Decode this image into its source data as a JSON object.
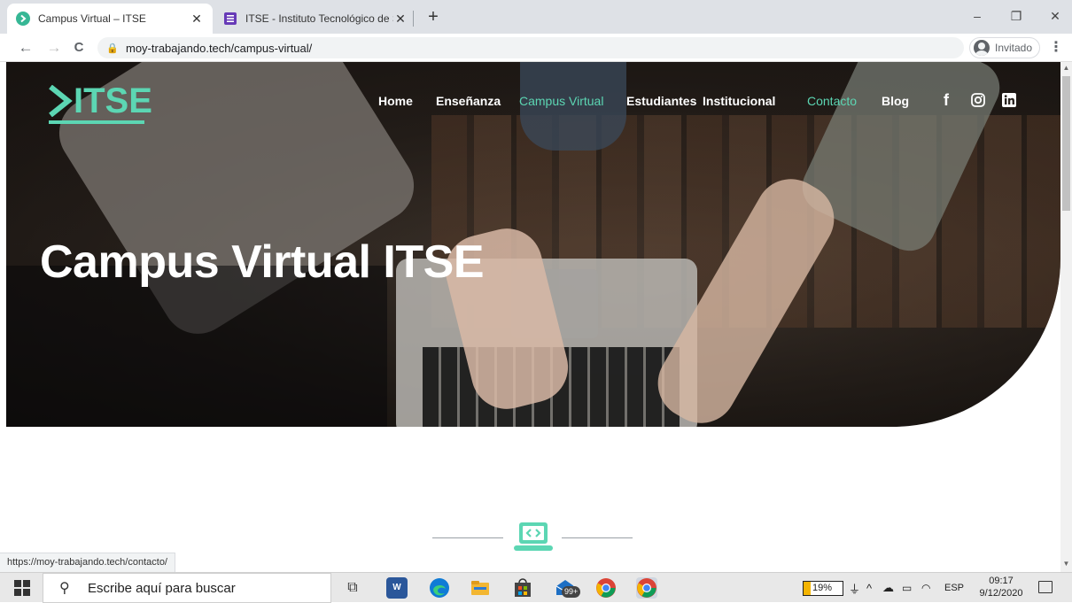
{
  "browser": {
    "tabs": [
      {
        "title": "Campus Virtual – ITSE",
        "active": true
      },
      {
        "title": "ITSE - Instituto Tecnológico de Sa",
        "active": false
      }
    ],
    "new_tab": "+",
    "window_controls": {
      "minimize": "–",
      "restore": "❐",
      "close": "✕"
    },
    "nav": {
      "back": "←",
      "forward": "→",
      "reload": "C"
    },
    "url": "moy-trabajando.tech/campus-virtual/",
    "profile_label": "Invitado",
    "menu": "⋮",
    "status_url": "https://moy-trabajando.tech/contacto/"
  },
  "site": {
    "logo": {
      "text": "ITSE",
      "color": "#5cd6b3"
    },
    "nav_items": [
      {
        "label": "Home",
        "active": false
      },
      {
        "label": "Enseñanza",
        "active": false
      },
      {
        "label": "Campus Virtual",
        "active": true
      },
      {
        "label": "Estudiantes",
        "active": false
      },
      {
        "label": "Institucional",
        "active": false
      },
      {
        "label": "Contacto",
        "active": true
      },
      {
        "label": "Blog",
        "active": false
      }
    ],
    "social": [
      {
        "icon": "facebook-icon",
        "glyph": "f"
      },
      {
        "icon": "instagram-icon",
        "glyph": "◎"
      },
      {
        "icon": "linkedin-icon",
        "glyph": "in"
      }
    ],
    "hero_title": "Campus Virtual ITSE",
    "accent_color": "#5cd6b3"
  },
  "taskbar": {
    "search_placeholder": "Escribe aquí para buscar",
    "apps": [
      {
        "name": "task-view",
        "label": "⧉"
      },
      {
        "name": "word",
        "label": "W"
      },
      {
        "name": "edge",
        "label": ""
      },
      {
        "name": "file-explorer",
        "label": ""
      },
      {
        "name": "store",
        "label": ""
      },
      {
        "name": "mail",
        "label": "99+"
      },
      {
        "name": "chrome",
        "label": ""
      },
      {
        "name": "chrome-2",
        "label": ""
      }
    ],
    "battery_percent": "19%",
    "battery_level": 0.19,
    "language": "ESP",
    "time": "09:17",
    "date": "9/12/2020"
  }
}
